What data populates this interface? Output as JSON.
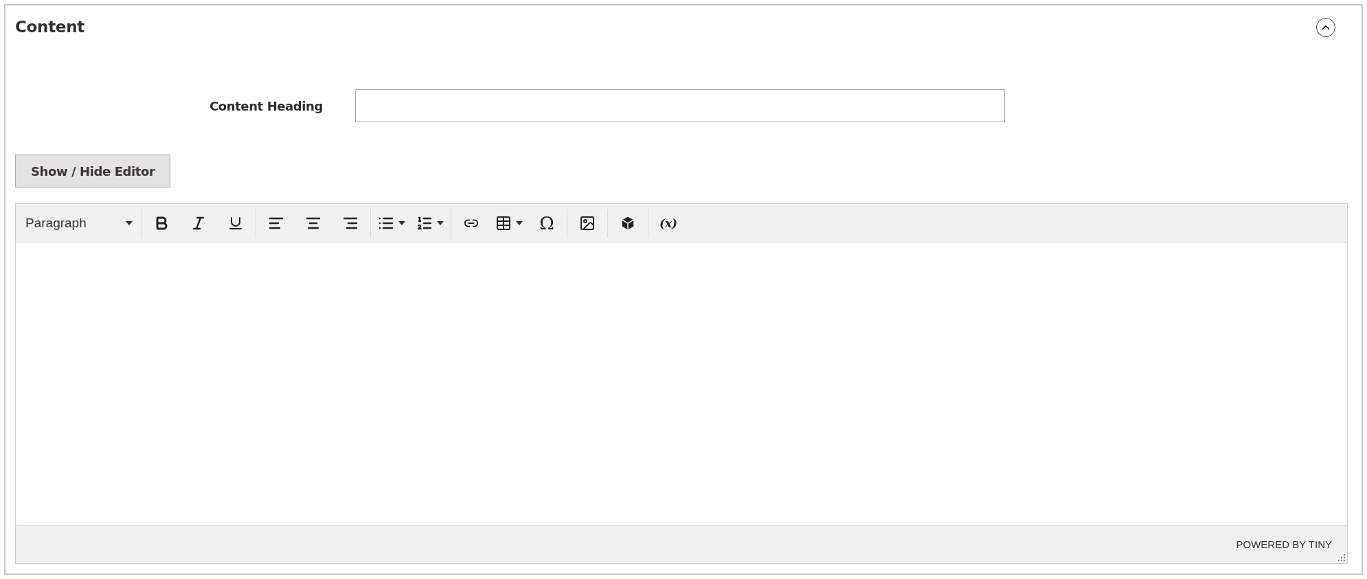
{
  "section": {
    "title": "Content",
    "expanded": true
  },
  "field": {
    "label": "Content Heading"
  },
  "toggle_button": "Show / Hide Editor",
  "toolbar": {
    "format": "Paragraph",
    "symbol_button": "Ω",
    "variable_button": "(x)"
  },
  "status_bar": {
    "branding": "POWERED BY TINY"
  }
}
